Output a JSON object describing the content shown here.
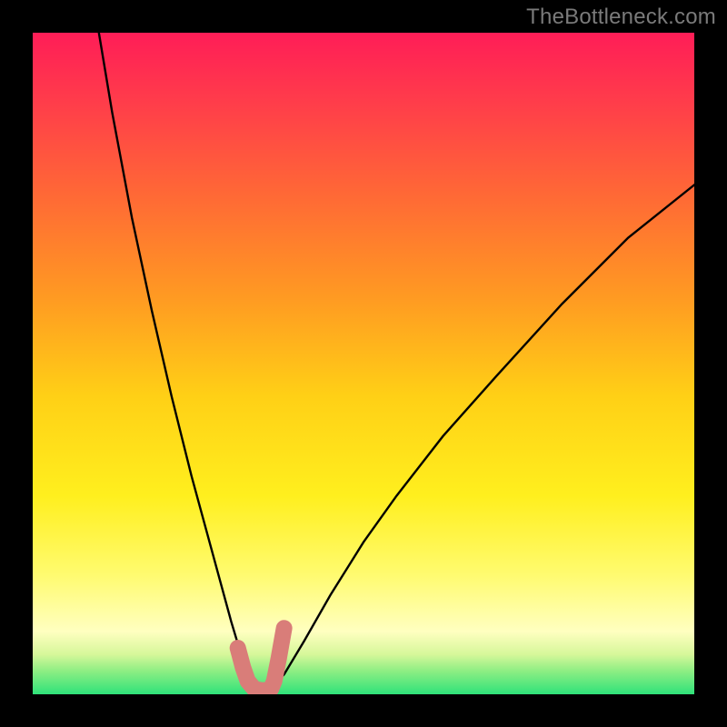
{
  "watermark": "TheBottleneck.com",
  "chart_data": {
    "type": "line",
    "title": "",
    "xlabel": "",
    "ylabel": "",
    "xlim": [
      0,
      100
    ],
    "ylim": [
      0,
      100
    ],
    "colorscale": {
      "description": "vertical gradient, value decreases downward: red/pink at top → orange → yellow → light-yellow → green band near bottom",
      "stops": [
        {
          "pos": 0.0,
          "color": "#ff1d57"
        },
        {
          "pos": 0.1,
          "color": "#ff3b4b"
        },
        {
          "pos": 0.25,
          "color": "#ff6a35"
        },
        {
          "pos": 0.4,
          "color": "#ff9a22"
        },
        {
          "pos": 0.55,
          "color": "#ffd016"
        },
        {
          "pos": 0.7,
          "color": "#ffef1e"
        },
        {
          "pos": 0.82,
          "color": "#fffb70"
        },
        {
          "pos": 0.905,
          "color": "#ffffc0"
        },
        {
          "pos": 0.94,
          "color": "#d6f79a"
        },
        {
          "pos": 0.965,
          "color": "#8dee83"
        },
        {
          "pos": 1.0,
          "color": "#2fe27a"
        }
      ]
    },
    "series": [
      {
        "name": "bottleneck-curve",
        "description": "V-shaped black curve, minimum (bottleneck ≈ 0) near x≈34; left branch rises steeply to y=100 at x≈10; right branch rises gently to y≈77 at x=100",
        "x": [
          10,
          12,
          15,
          18,
          21,
          24,
          27,
          30,
          31.5,
          33,
          34,
          35,
          36,
          38,
          41,
          45,
          50,
          55,
          62,
          70,
          80,
          90,
          100
        ],
        "y": [
          100,
          88,
          72,
          58,
          45,
          33,
          22,
          11,
          6,
          2,
          0.5,
          0.5,
          1,
          3,
          8,
          15,
          23,
          30,
          39,
          48,
          59,
          69,
          77
        ]
      },
      {
        "name": "highlighted-min-segment",
        "description": "thick salmon/light-red stroke overlaying the curve near its minimum, forming a small cup shape",
        "color": "#d97d79",
        "x": [
          31.0,
          31.8,
          32.5,
          33.5,
          34.5,
          35.5,
          36.0,
          36.5,
          37.2,
          38.0
        ],
        "y": [
          7.0,
          4.0,
          2.0,
          0.8,
          0.6,
          0.6,
          0.8,
          2.0,
          5.5,
          10.0
        ]
      }
    ]
  }
}
